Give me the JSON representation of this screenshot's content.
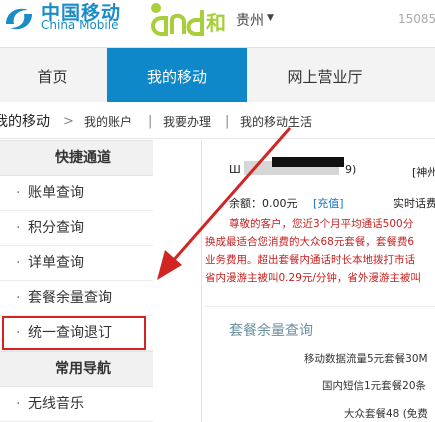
{
  "header": {
    "logo_cn": "中国移动",
    "logo_en": "China Mobile",
    "and_logo_text": "和",
    "city": "贵州",
    "phone_partial": "15085"
  },
  "nav": {
    "tabs": [
      {
        "label": "首页",
        "active": false
      },
      {
        "label": "我的移动",
        "active": true
      },
      {
        "label": "网上营业厅",
        "active": false
      }
    ]
  },
  "breadcrumb": {
    "root": "我的移动",
    "sep1": ">",
    "items": [
      "我的账户",
      "我要办理",
      "我的移动生活"
    ],
    "divider": "|"
  },
  "sidebar": {
    "section1": "快捷通道",
    "items": [
      "账单查询",
      "积分查询",
      "详单查询",
      "套餐余量查询",
      "统一查询退订"
    ],
    "section2": "常用导航",
    "items2": [
      "无线音乐"
    ],
    "highlighted": "统一查询退订"
  },
  "main": {
    "account_prefix": "Ш",
    "account_suffix": "9)",
    "brand": "[神州",
    "balance": "余额：0.00元",
    "recharge": "[充值]",
    "realtime": "实时话费",
    "notice_lines": [
      "尊敬的客户，您近3个月平均通话500分",
      "换成最适合您消费的大众68元套餐，套餐费6",
      "业务费用。超出套餐内通话时长本地拨打市话",
      "省内漫游主被叫0.29元/分钟，省外漫游主被叫"
    ],
    "pkg_title": "套餐余量查询",
    "pkg_rows": [
      "移动数据流量5元套餐30M",
      "国内短信1元套餐20条",
      "大众套餐48 (免费"
    ]
  },
  "colors": {
    "brand_blue": "#0e88c9",
    "notice_red": "#c62020",
    "highlight_red": "#d32424"
  }
}
